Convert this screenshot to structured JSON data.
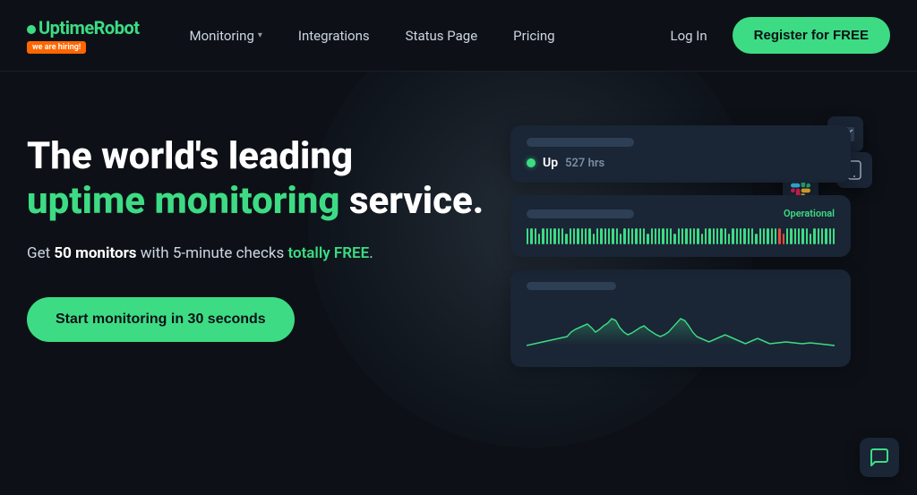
{
  "brand": {
    "name": "UptimeRobot",
    "dot": "•",
    "badge": "we are hiring!"
  },
  "nav": {
    "links": [
      {
        "label": "Monitoring",
        "hasDropdown": true
      },
      {
        "label": "Integrations",
        "hasDropdown": false
      },
      {
        "label": "Status Page",
        "hasDropdown": false
      },
      {
        "label": "Pricing",
        "hasDropdown": false
      }
    ],
    "login_label": "Log In",
    "register_label": "Register for FREE"
  },
  "hero": {
    "title_line1": "The world's leading",
    "title_line2_green": "uptime monitoring",
    "title_line2_rest": " service.",
    "subtitle_pre": "Get ",
    "subtitle_bold": "50 monitors",
    "subtitle_mid": " with 5-minute checks ",
    "subtitle_green": "totally FREE",
    "subtitle_end": ".",
    "cta_label": "Start monitoring in 30 seconds"
  },
  "dashboard": {
    "card1": {
      "status": "Up",
      "hours": "527 hrs"
    },
    "card2": {
      "operational": "Operational"
    },
    "icons": [
      {
        "name": "mail",
        "symbol": "✉",
        "bg": "#1a2535"
      },
      {
        "name": "telegram",
        "symbol": "✈",
        "bg": "#229ED9"
      },
      {
        "name": "slack",
        "symbol": "#",
        "bg": "#1a2535"
      },
      {
        "name": "phone",
        "symbol": "📱",
        "bg": "#1a2535"
      }
    ]
  },
  "chat": {
    "icon": "💬"
  }
}
